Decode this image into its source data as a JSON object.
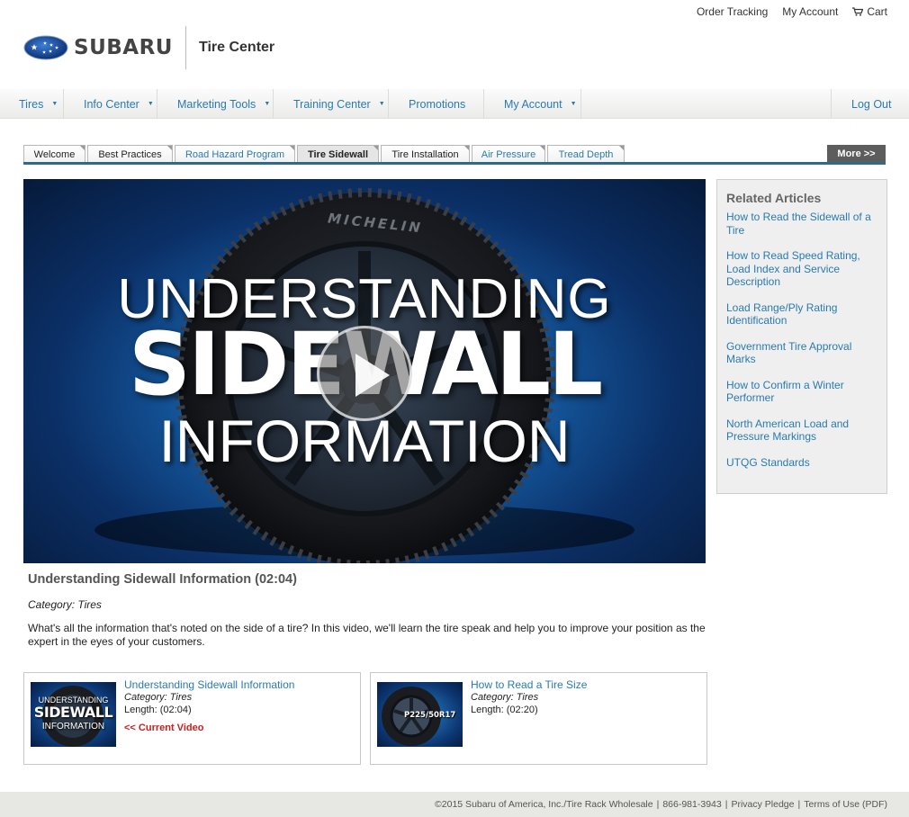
{
  "header": {
    "top_links": [
      "Order Tracking",
      "My Account",
      "Cart"
    ],
    "brand": "SUBARU",
    "subtitle": "Tire Center"
  },
  "nav": {
    "items": [
      "Tires",
      "Info Center",
      "Marketing Tools",
      "Training Center",
      "Promotions",
      "My Account"
    ],
    "logout": "Log Out"
  },
  "tabs": {
    "items": [
      "Welcome",
      "Best Practices",
      "Road Hazard Program",
      "Tire Sidewall",
      "Tire Installation",
      "Air Pressure",
      "Tread Depth"
    ],
    "active": "Tire Sidewall",
    "more": "More >>"
  },
  "video": {
    "line1": "UNDERSTANDING",
    "line2": "SIDEWALL",
    "line3": "INFORMATION",
    "brand_on_tire": "MICHELIN",
    "title": "Understanding Sidewall Information (02:04)",
    "category": "Category: Tires",
    "description": "What's all the information that's noted on the side of a tire? In this video, we'll learn the tire speak and help you to improve your position as the expert in the eyes of your customers."
  },
  "cards": [
    {
      "title": "Understanding Sidewall Information",
      "category": "Category: Tires",
      "length": "Length: (02:04)",
      "current": "<< Current Video",
      "thumb_line1": "UNDERSTANDING",
      "thumb_line2": "SIDEWALL",
      "thumb_line3": "INFORMATION"
    },
    {
      "title": "How to Read a Tire Size",
      "category": "Category: Tires",
      "length": "Length: (02:20)",
      "thumb_label": "P225/50R17"
    }
  ],
  "sidebar": {
    "heading": "Related Articles",
    "articles": [
      "How to Read the Sidewall of a Tire",
      "How to Read Speed Rating, Load Index and Service Description",
      "Load Range/Ply Rating Identification",
      "Government Tire Approval Marks",
      "How to Confirm a Winter Performer",
      "North American Load and Pressure Markings",
      "UTQG Standards"
    ]
  },
  "footer": {
    "copyright": "©2015 Subaru of America, Inc./Tire Rack Wholesale",
    "phone": "866-981-3943",
    "privacy": "Privacy Pledge",
    "terms": "Terms of Use (PDF)"
  },
  "colors": {
    "link": "#2a7ab0",
    "tab_rule": "#2f6a86",
    "current_video": "#c8201e",
    "logo_blue": "#1a4fa0"
  }
}
